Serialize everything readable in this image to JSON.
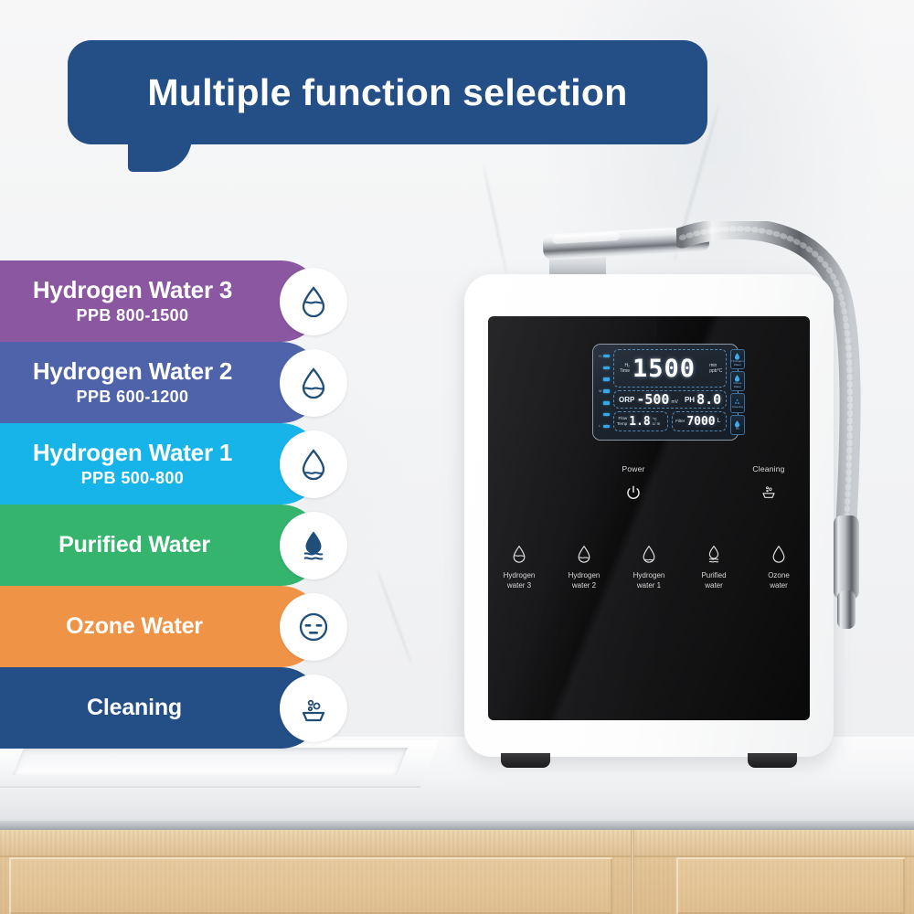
{
  "banner": {
    "title": "Multiple function selection",
    "bg_color": "#234e86",
    "text_color": "#ffffff"
  },
  "functions": [
    {
      "name": "hydrogen-water-3",
      "title": "Hydrogen Water 3",
      "subtitle": "PPB 800-1500",
      "color": "#8a57a0",
      "icon": "water-drop-high-icon",
      "fill_level": 0.58
    },
    {
      "name": "hydrogen-water-2",
      "title": "Hydrogen Water 2",
      "subtitle": "PPB 600-1200",
      "color": "#4f63ab",
      "icon": "water-drop-mid-icon",
      "fill_level": 0.36
    },
    {
      "name": "hydrogen-water-1",
      "title": "Hydrogen Water 1",
      "subtitle": "PPB 500-800",
      "color": "#17b4e9",
      "icon": "water-drop-low-icon",
      "fill_level": 0.2
    },
    {
      "name": "purified-water",
      "title": "Purified Water",
      "subtitle": "",
      "color": "#35b46e",
      "icon": "drop-waves-icon",
      "fill_level": 0
    },
    {
      "name": "ozone-water",
      "title": "Ozone Water",
      "subtitle": "",
      "color": "#ef9346",
      "icon": "face-icon",
      "fill_level": 0
    },
    {
      "name": "cleaning",
      "title": "Cleaning",
      "subtitle": "",
      "color": "#234e86",
      "icon": "cleaning-basin-icon",
      "fill_level": 0
    }
  ],
  "device": {
    "lcd": {
      "gauge_tags": [
        "H",
        "M",
        "L"
      ],
      "gauge_segments": 7,
      "row1": {
        "label_line1": "H₂",
        "label_line2": "Time",
        "value": "1500",
        "unit_line1": "min",
        "unit_line2": "ppb°C"
      },
      "row2": {
        "orp_label": "ORP",
        "orp_value": "-500",
        "orp_unit": "mV",
        "ph_label": "PH",
        "ph_value": "8.0"
      },
      "flow": {
        "label_line1": "Flow",
        "label_line2": "Temp",
        "value": "1.8",
        "unit_line1": "°C",
        "unit_line2": "L/ m"
      },
      "filter": {
        "label": "Filter",
        "value": "7000",
        "unit": "L"
      },
      "side_buttons": [
        {
          "name": "side-btn-hydrogen-water",
          "label": "Hydrogen Water",
          "icon": "droplet-icon"
        },
        {
          "name": "side-btn-ozone-water",
          "label": "Ozone Water",
          "icon": "droplet-icon"
        },
        {
          "name": "side-btn-cleaning",
          "label": "Cleaning",
          "icon": "recycle-icon"
        },
        {
          "name": "side-btn-ph",
          "label": "Ph",
          "icon": "droplet-icon"
        }
      ]
    },
    "controls": {
      "power": {
        "name": "power-button",
        "label": "Power",
        "icon": "power-icon"
      },
      "cleaning": {
        "name": "cleaning-button",
        "label": "Cleaning",
        "icon": "cleaning-basin-icon"
      },
      "buttons": [
        {
          "name": "touch-hydrogen-water-3",
          "label_line1": "Hydrogen",
          "label_line2": "water  3",
          "icon": "drop-high-icon"
        },
        {
          "name": "touch-hydrogen-water-2",
          "label_line1": "Hydrogen",
          "label_line2": "water  2",
          "icon": "drop-mid-icon"
        },
        {
          "name": "touch-hydrogen-water-1",
          "label_line1": "Hydrogen",
          "label_line2": "water  1",
          "icon": "drop-low-icon"
        },
        {
          "name": "touch-purified-water",
          "label_line1": "Purified",
          "label_line2": "water",
          "icon": "drop-waves-icon"
        },
        {
          "name": "touch-ozone-water",
          "label_line1": "Ozone",
          "label_line2": "water",
          "icon": "drop-plain-icon"
        }
      ]
    }
  },
  "scene": {
    "wall_color": "#f4f5f6",
    "counter_color": "#f2f3f5",
    "cabinet_color": "#e2c498"
  }
}
